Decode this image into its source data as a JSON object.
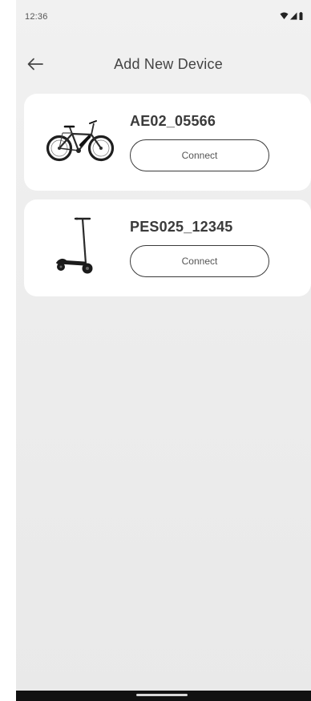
{
  "status_bar": {
    "time": "12:36",
    "icons": [
      "wifi-icon",
      "signal-icon",
      "battery-icon"
    ]
  },
  "header": {
    "title": "Add New Device",
    "back_icon": "arrow-left-icon"
  },
  "devices": [
    {
      "name": "AE02_05566",
      "connect_label": "Connect",
      "image": "bicycle"
    },
    {
      "name": "PES025_12345",
      "connect_label": "Connect",
      "image": "kick-scooter"
    }
  ],
  "colors": {
    "background": "#eeeeee",
    "card": "#ffffff",
    "text_primary": "#3a3a3a",
    "button_border": "#3a3a3a",
    "nav_bar": "#111111"
  }
}
